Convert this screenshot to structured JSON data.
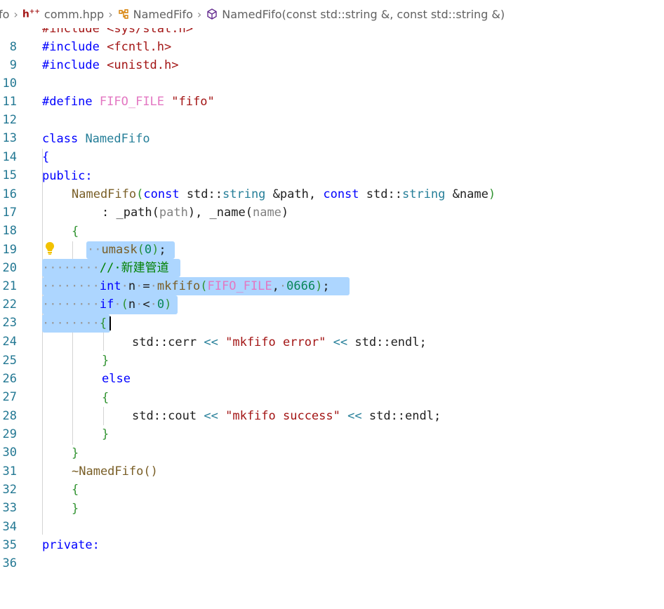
{
  "breadcrumb": {
    "folder": "fo",
    "file": "comm.hpp",
    "class_name": "NamedFifo",
    "member": "NamedFifo(const std::string &, const std::string &)"
  },
  "line_numbers": [
    "8",
    "9",
    "10",
    "11",
    "12",
    "13",
    "14",
    "15",
    "16",
    "17",
    "18",
    "19",
    "20",
    "21",
    "22",
    "23",
    "24",
    "25",
    "26",
    "27",
    "28",
    "29",
    "30",
    "31",
    "32",
    "33",
    "34",
    "35",
    "36"
  ],
  "code": {
    "l8": "#include <sys/stat.h>",
    "l9_kw": "#include",
    "l9_hdr": "<fcntl.h>",
    "l10_kw": "#include",
    "l10_hdr": "<unistd.h>",
    "l12_kw": "#define",
    "l12_name": "FIFO_FILE",
    "l12_val": "\"fifo\"",
    "l14_kw": "class",
    "l14_name": "NamedFifo",
    "l15": "{",
    "l16": "public:",
    "l17_fn": "NamedFifo",
    "l17_const1": "const",
    "l17_std1": "std::",
    "l17_type1": "string",
    "l17_p1": "&path",
    "l17_const2": "const",
    "l17_std2": "std::",
    "l17_type2": "string",
    "l17_p2": "&name",
    "l18_a": ": _path(",
    "l18_b": "path",
    "l18_c": "), _name(",
    "l18_d": "name",
    "l18_e": ")",
    "l19": "{",
    "l20_fn": "umask",
    "l20_num": "0",
    "l21_cmt": "//·新建管道",
    "l22_kw": "int",
    "l22_var": "n",
    "l22_fn": "mkfifo",
    "l22_mac": "FIFO_FILE",
    "l22_num": "0666",
    "l23_kw": "if",
    "l23_var": "n",
    "l23_num": "0",
    "l24": "{",
    "l25_a": "std::cerr",
    "l25_op1": "<<",
    "l25_str": "\"mkfifo error\"",
    "l25_op2": "<<",
    "l25_b": "std::endl;",
    "l26": "}",
    "l27": "else",
    "l28": "{",
    "l29_a": "std::cout",
    "l29_op1": "<<",
    "l29_str": "\"mkfifo success\"",
    "l29_op2": "<<",
    "l29_b": "std::endl;",
    "l30": "}",
    "l31": "}",
    "l32": "~NamedFifo()",
    "l33": "{",
    "l34": "}",
    "l36": "private:"
  }
}
